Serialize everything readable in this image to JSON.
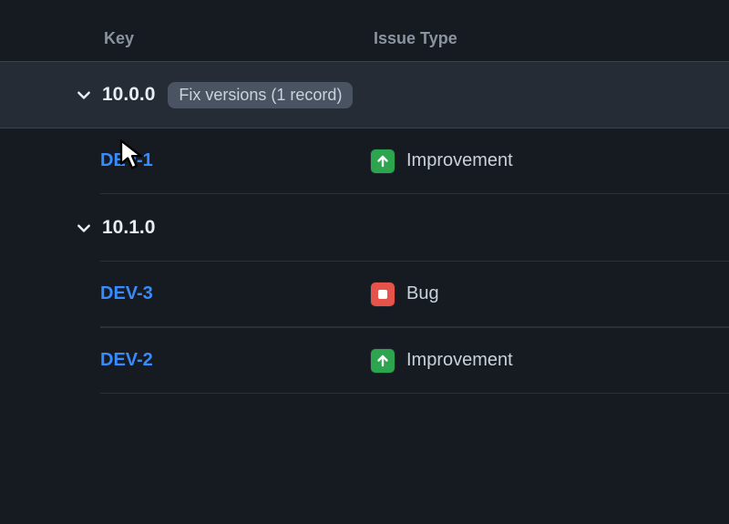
{
  "headers": {
    "key": "Key",
    "type": "Issue Type"
  },
  "groups": [
    {
      "title": "10.0.0",
      "badge": "Fix versions (1 record)",
      "highlight": true,
      "rows": [
        {
          "key": "DEV-1",
          "type": "Improvement",
          "icon": "improvement"
        }
      ]
    },
    {
      "title": "10.1.0",
      "badge": null,
      "highlight": false,
      "rows": [
        {
          "key": "DEV-3",
          "type": "Bug",
          "icon": "bug"
        },
        {
          "key": "DEV-2",
          "type": "Improvement",
          "icon": "improvement"
        }
      ]
    }
  ]
}
